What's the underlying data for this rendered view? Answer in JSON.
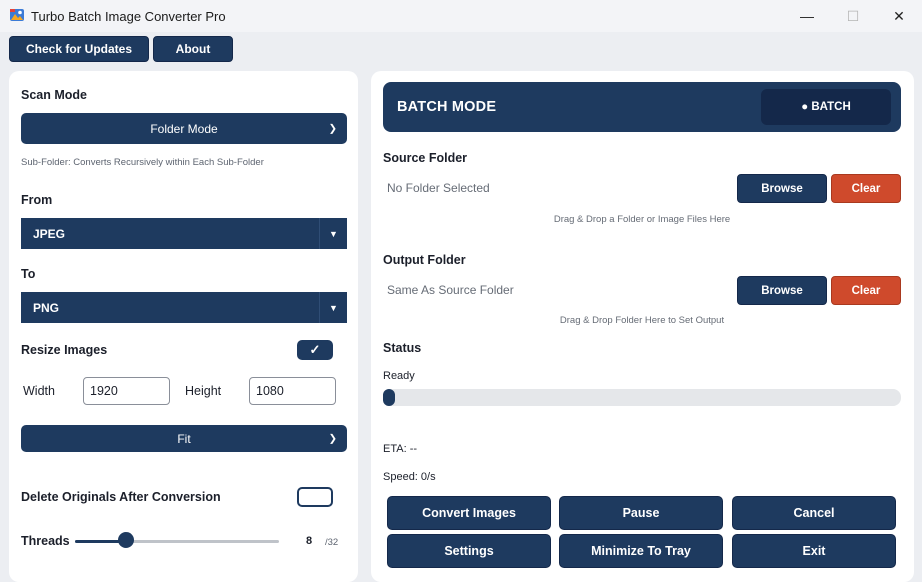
{
  "window": {
    "title": "Turbo Batch Image Converter Pro",
    "app_icon": "photo-app-icon",
    "minimize_glyph": "—",
    "maximize_glyph": "☐",
    "close_glyph": "✕"
  },
  "toolbar": {
    "check_updates_label": "Check for Updates",
    "about_label": "About"
  },
  "left": {
    "scan_mode_label": "Scan Mode",
    "scan_mode_value": "Folder Mode",
    "scan_mode_hint": "Sub-Folder: Converts Recursively within Each Sub-Folder",
    "from_label": "From",
    "from_value": "JPEG",
    "to_label": "To",
    "to_value": "PNG",
    "resize_label": "Resize Images",
    "resize_checked": true,
    "width_label": "Width",
    "width_value": "1920",
    "height_label": "Height",
    "height_value": "1080",
    "fit_value": "Fit",
    "delete_label": "Delete Originals After Conversion",
    "delete_checked": false,
    "threads_label": "Threads",
    "threads_value": "8",
    "threads_max": "/32",
    "threads_fraction": 0.25
  },
  "right": {
    "banner_title": "BATCH MODE",
    "banner_badge": "● BATCH",
    "source_title": "Source Folder",
    "source_path": "No Folder Selected",
    "source_hint": "Drag & Drop a Folder or Image Files Here",
    "output_title": "Output Folder",
    "output_path": "Same As Source Folder",
    "output_hint": "Drag & Drop Folder Here to Set Output",
    "browse_label": "Browse",
    "clear_label": "Clear",
    "status_title": "Status",
    "status_value": "Ready",
    "progress_fraction": 0,
    "eta": "ETA: --",
    "speed": "Speed: 0/s"
  },
  "actions": {
    "convert": "Convert Images",
    "pause": "Pause",
    "cancel": "Cancel",
    "settings": "Settings",
    "minimize_tray": "Minimize To Tray",
    "exit": "Exit"
  },
  "colors": {
    "primary": "#1e3a5f",
    "danger": "#cf4a2c",
    "background": "#eceef2",
    "panel": "#ffffff"
  }
}
